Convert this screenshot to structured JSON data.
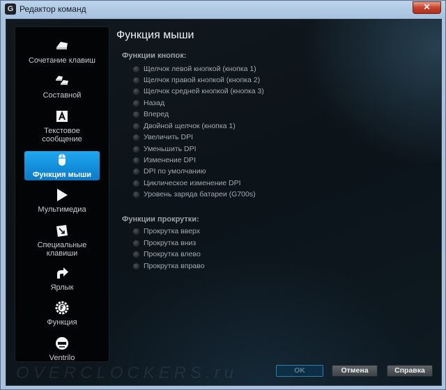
{
  "window": {
    "title": "Редактор команд",
    "app_icon_letter": "G",
    "close_glyph": "✕"
  },
  "sidebar": {
    "items": [
      {
        "label": "Сочетание клавиш",
        "icon": "keys-icon",
        "active": false
      },
      {
        "label": "Составной",
        "icon": "multikey-icon",
        "active": false
      },
      {
        "label": "Текстовое сообщение",
        "icon": "text-block-icon",
        "active": false
      },
      {
        "label": "Функция мыши",
        "icon": "mouse-icon",
        "active": true
      },
      {
        "label": "Мультимедиа",
        "icon": "play-icon",
        "active": false
      },
      {
        "label": "Специальные клавиши",
        "icon": "special-key-icon",
        "active": false
      },
      {
        "label": "Ярлык",
        "icon": "shortcut-arrow-icon",
        "active": false
      },
      {
        "label": "Функция",
        "icon": "function-gear-icon",
        "active": false
      },
      {
        "label": "Ventrilo",
        "icon": "headset-icon",
        "active": false
      }
    ]
  },
  "main": {
    "heading": "Функция мыши",
    "button_section": {
      "label": "Функции кнопок:",
      "options": [
        "Щелчок левой кнопкой (кнопка 1)",
        "Щелчок правой кнопкой (кнопка 2)",
        "Щелчок средней кнопкой (кнопка 3)",
        "Назад",
        "Вперед",
        "Двойной щелчок (кнопка 1)",
        "Увеличить DPI",
        "Уменьшить DPI",
        "Изменение DPI",
        "DPI по умолчанию",
        "Циклическое изменение DPI",
        "Уровень заряда батареи (G700s)"
      ]
    },
    "scroll_section": {
      "label": "Функции прокрутки:",
      "options": [
        "Прокрутка вверх",
        "Прокрутка вниз",
        "Прокрутка влево",
        "Прокрутка вправо"
      ]
    }
  },
  "footer": {
    "ok_label": "OK",
    "cancel_label": "Отмена",
    "help_label": "Справка",
    "watermark": "OVERCLOCKERS.ru"
  },
  "colors": {
    "accent": "#1a9be8",
    "background": "#0c1319",
    "sidebar": "#030405"
  }
}
